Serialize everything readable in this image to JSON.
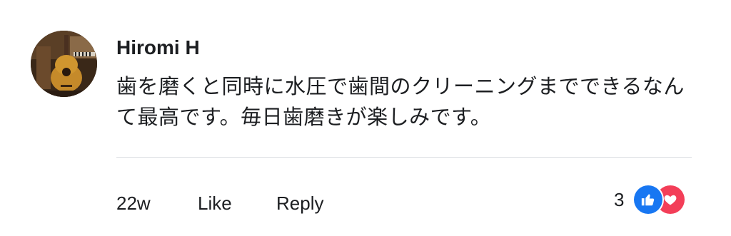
{
  "comment": {
    "author": "Hiromi H",
    "text": "歯を磨くと同時に水圧で歯間のクリーニングまでできるなんて最高です。毎日歯磨きが楽しみです。",
    "time": "22w",
    "actions": {
      "like_label": "Like",
      "reply_label": "Reply"
    },
    "reactions": {
      "count": "3",
      "icons": [
        "thumbs-up-icon",
        "heart-icon"
      ],
      "colors": {
        "like": "#1877f2",
        "love": "#f33e58"
      }
    }
  },
  "colors": {
    "text": "#1c1e21",
    "divider": "#dadde1",
    "background": "#ffffff"
  }
}
